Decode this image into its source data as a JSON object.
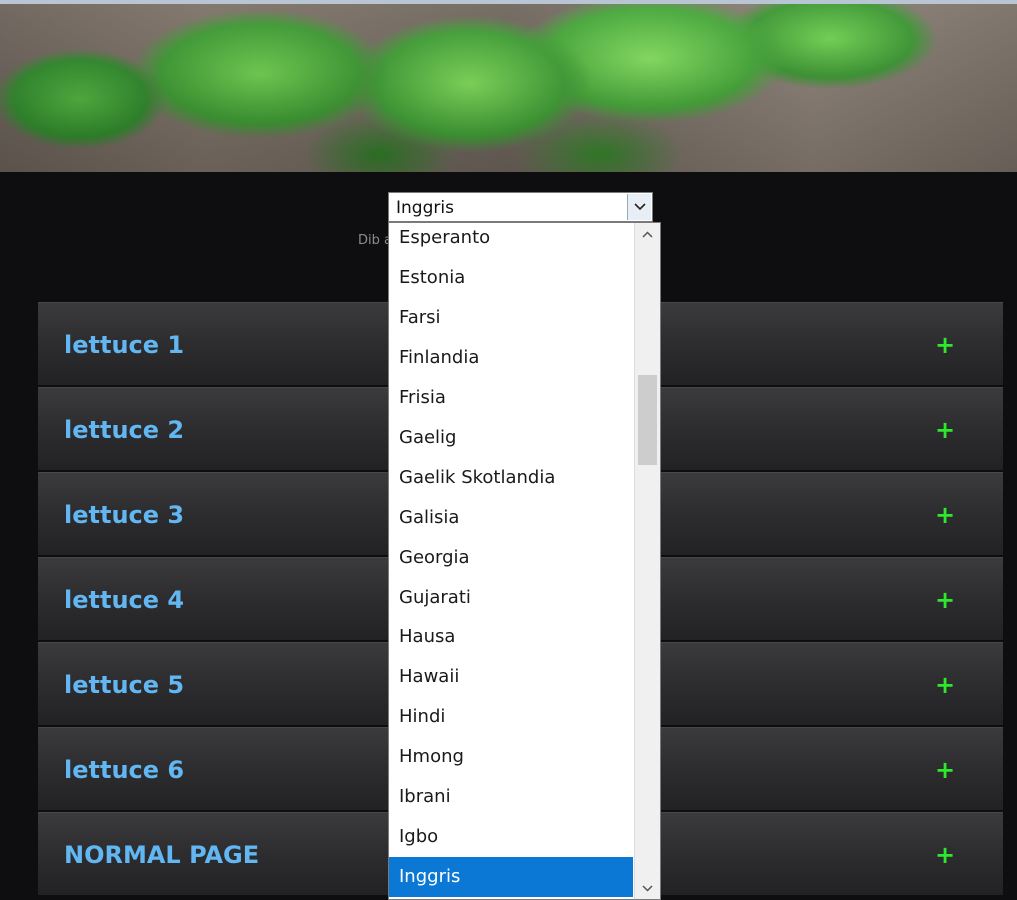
{
  "language_select": {
    "selected_value": "Inggris",
    "options": [
      "Esperanto",
      "Estonia",
      "Farsi",
      "Finlandia",
      "Frisia",
      "Gaelig",
      "Gaelik Skotlandia",
      "Galisia",
      "Georgia",
      "Gujarati",
      "Hausa",
      "Hawaii",
      "Hindi",
      "Hmong",
      "Ibrani",
      "Igbo",
      "Inggris"
    ],
    "highlighted_option": "Inggris"
  },
  "powered_by_text": "Dib                                                  an",
  "accordion": {
    "items": [
      {
        "title": "lettuce 1",
        "toggle": "+"
      },
      {
        "title": "lettuce 2",
        "toggle": "+"
      },
      {
        "title": "lettuce 3",
        "toggle": "+"
      },
      {
        "title": "lettuce 4",
        "toggle": "+"
      },
      {
        "title": "lettuce 5",
        "toggle": "+"
      },
      {
        "title": "lettuce 6",
        "toggle": "+"
      },
      {
        "title": "NORMAL PAGE",
        "toggle": "+"
      }
    ]
  },
  "icons": {
    "select_arrow": "chevron-down-icon",
    "scroll_up": "chevron-up-icon",
    "scroll_down": "chevron-down-icon"
  },
  "colors": {
    "page_background": "#0e0e10",
    "accordion_title": "#62b7f3",
    "accordion_plus": "#2ee82e",
    "selected_option": "#0b78d6"
  }
}
